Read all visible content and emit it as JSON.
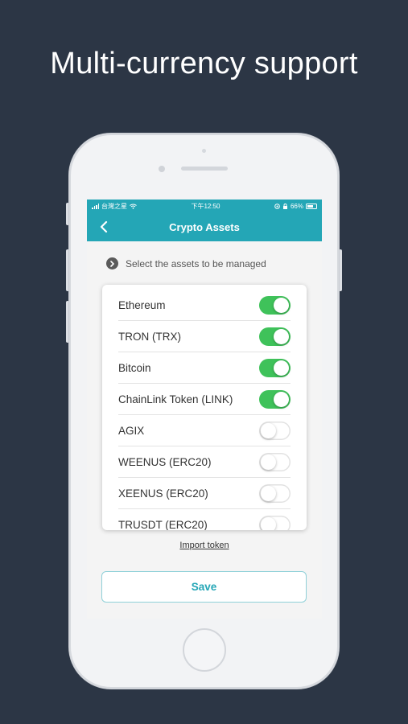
{
  "headline": "Multi-currency support",
  "status_bar": {
    "carrier": "台灣之星",
    "time": "下午12:50",
    "battery": "66%"
  },
  "nav": {
    "title": "Crypto Assets",
    "back_icon": "chevron-left-icon"
  },
  "hint": {
    "icon": "chevron-right-circle-icon",
    "text": "Select the assets to be managed"
  },
  "assets": [
    {
      "name": "Ethereum",
      "enabled": true
    },
    {
      "name": "TRON (TRX)",
      "enabled": true
    },
    {
      "name": "Bitcoin",
      "enabled": true
    },
    {
      "name": "ChainLink Token (LINK)",
      "enabled": true
    },
    {
      "name": "AGIX",
      "enabled": false
    },
    {
      "name": "WEENUS (ERC20)",
      "enabled": false
    },
    {
      "name": "XEENUS (ERC20)",
      "enabled": false
    },
    {
      "name": "TRUSDT (ERC20)",
      "enabled": false
    }
  ],
  "import_link": "Import token",
  "save_label": "Save",
  "colors": {
    "background": "#2c3645",
    "accent": "#24a6b6",
    "toggle_on": "#3fc25a"
  }
}
